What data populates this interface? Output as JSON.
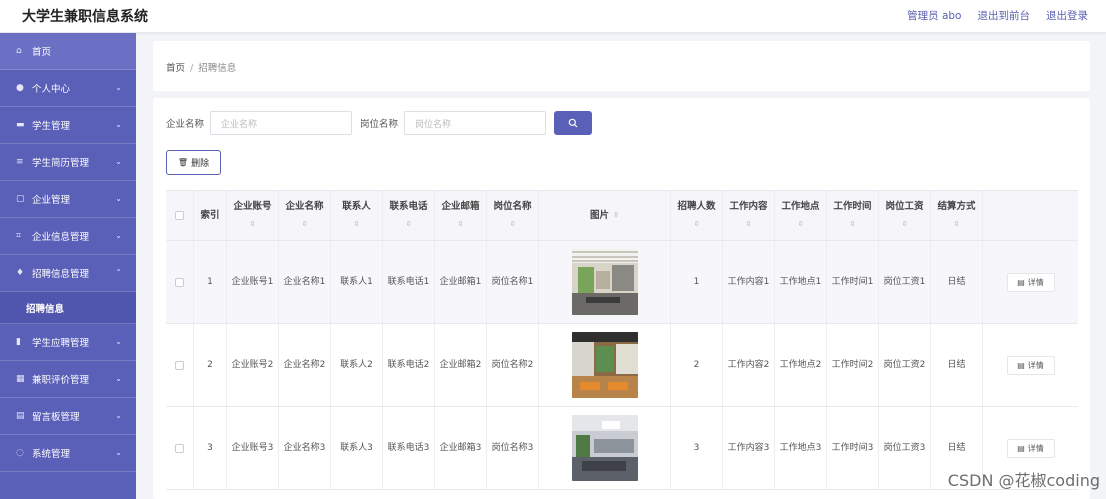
{
  "app": {
    "title": "大学生兼职信息系统"
  },
  "top_links": {
    "admin": "管理员 abo",
    "front": "退出到前台",
    "logout": "退出登录"
  },
  "sidebar": {
    "items": [
      {
        "label": "首页",
        "icon": "home-icon"
      },
      {
        "label": "个人中心",
        "icon": "user-icon"
      },
      {
        "label": "学生管理",
        "icon": "student-icon"
      },
      {
        "label": "学生简历管理",
        "icon": "list-icon"
      },
      {
        "label": "企业管理",
        "icon": "building-icon"
      },
      {
        "label": "企业信息管理",
        "icon": "scan-icon"
      },
      {
        "label": "招聘信息管理",
        "icon": "mic-icon"
      },
      {
        "label": "学生应聘管理",
        "icon": "clipboard-icon"
      },
      {
        "label": "兼职评价管理",
        "icon": "grid-icon"
      },
      {
        "label": "留言板管理",
        "icon": "message-icon"
      },
      {
        "label": "系统管理",
        "icon": "settings-icon"
      }
    ],
    "sub_active": "招聘信息"
  },
  "breadcrumb": {
    "home": "首页",
    "separator": "/",
    "current": "招聘信息"
  },
  "search": {
    "company_label": "企业名称",
    "company_placeholder": "企业名称",
    "position_label": "岗位名称",
    "position_placeholder": "岗位名称"
  },
  "delete_label": "删除",
  "table": {
    "headers": [
      "索引",
      "企业账号",
      "企业名称",
      "联系人",
      "联系电话",
      "企业邮箱",
      "岗位名称",
      "图片",
      "招聘人数",
      "工作内容",
      "工作地点",
      "工作时间",
      "岗位工资",
      "结算方式"
    ],
    "rows": [
      {
        "index": "1",
        "account": "企业账号1",
        "company": "企业名称1",
        "contact": "联系人1",
        "phone": "联系电话1",
        "email": "企业邮箱1",
        "position": "岗位名称1",
        "count": "1",
        "content": "工作内容1",
        "location": "工作地点1",
        "time": "工作时间1",
        "salary": "岗位工资1",
        "settle": "日结",
        "detail": "详情"
      },
      {
        "index": "2",
        "account": "企业账号2",
        "company": "企业名称2",
        "contact": "联系人2",
        "phone": "联系电话2",
        "email": "企业邮箱2",
        "position": "岗位名称2",
        "count": "2",
        "content": "工作内容2",
        "location": "工作地点2",
        "time": "工作时间2",
        "salary": "岗位工资2",
        "settle": "日结",
        "detail": "详情"
      },
      {
        "index": "3",
        "account": "企业账号3",
        "company": "企业名称3",
        "contact": "联系人3",
        "phone": "联系电话3",
        "email": "企业邮箱3",
        "position": "岗位名称3",
        "count": "3",
        "content": "工作内容3",
        "location": "工作地点3",
        "time": "工作时间3",
        "salary": "岗位工资3",
        "settle": "日结",
        "detail": "详情"
      }
    ]
  },
  "watermark": "CSDN @花椒coding",
  "colors": {
    "accent": "#5a5fb8"
  }
}
